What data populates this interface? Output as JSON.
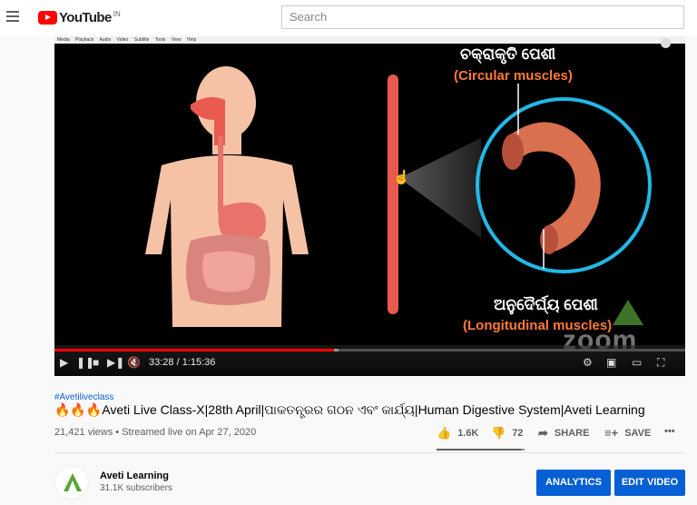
{
  "header": {
    "menu_icon": "hamburger-menu-icon",
    "logo_text": "YouTube",
    "logo_country": "IN",
    "search_placeholder": "Search"
  },
  "player": {
    "menu_items": [
      "Media",
      "Playback",
      "Audio",
      "Video",
      "Subtitle",
      "Tools",
      "View",
      "Help"
    ],
    "slide": {
      "top_label_odia": "ଚକ୍ରାକୃତି ପେଶୀ",
      "top_label_en": "(Circular muscles)",
      "bottom_label_odia": "ଅନୁଦୈର୍ଘ୍ୟ ପେଶୀ",
      "bottom_label_en": "(Longitudinal muscles)",
      "watermark": "zoom"
    },
    "time_current": "33:28",
    "time_total": "1:15:36",
    "time_display": "33:28 / 1:15:36",
    "progress_played": 0.443,
    "progress_loaded": 0.45,
    "colors": {
      "progress": "#ff0000",
      "label_en": "#ff7a3a",
      "ring": "#22b8e8"
    }
  },
  "video": {
    "hashtag": "#Avetiliveclass",
    "title_prefix": "🔥🔥🔥",
    "title": "Aveti Live Class-X|28th April|ପାକତନ୍ତ୍ରର ଗଠନ ଏବଂ କାର୍ଯ୍ୟ|Human Digestive System|Aveti Learning",
    "views": "21,421 views",
    "separator": "•",
    "streamed": "Streamed live on Apr 27, 2020",
    "likes": "1.6K",
    "dislikes": "72",
    "share_label": "SHARE",
    "save_label": "SAVE",
    "more_label": "•••",
    "like_ratio": 0.957
  },
  "channel": {
    "name": "Aveti Learning",
    "subscribers": "31.1K subscribers",
    "analytics_label": "ANALYTICS",
    "edit_label": "EDIT VIDEO",
    "accent": "#065fd4"
  }
}
